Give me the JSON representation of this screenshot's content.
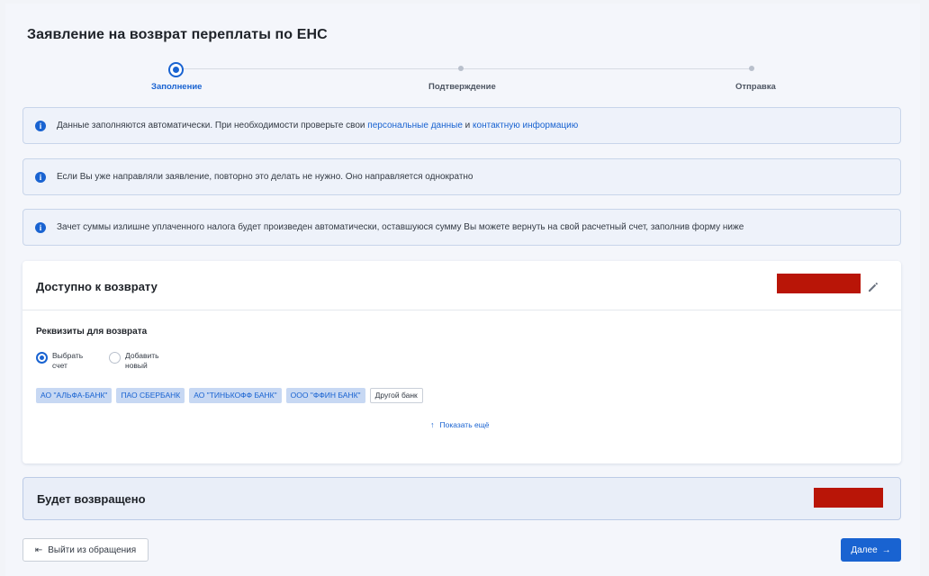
{
  "title": "Заявление на возврат переплаты по ЕНС",
  "stepper": {
    "steps": [
      {
        "label": "Заполнение",
        "state": "active"
      },
      {
        "label": "Подтверждение",
        "state": "pending"
      },
      {
        "label": "Отправка",
        "state": "pending"
      }
    ]
  },
  "info_boxes": [
    {
      "icon": "info-icon",
      "text_before": "Данные заполняются автоматически. При необходимости проверьте свои ",
      "link1": "персональные данные",
      "text_middle": " и ",
      "link2": "контактную информацию"
    },
    {
      "icon": "info-icon",
      "text": "Если Вы уже направляли заявление, повторно это делать не нужно. Оно направляется однократно"
    },
    {
      "icon": "info-icon",
      "text": "Зачет суммы излишне уплаченного налога будет произведен автоматически, оставшуюся сумму Вы можете вернуть на свой расчетный счет, заполнив форму ниже"
    }
  ],
  "available": {
    "title": "Доступно к возврату",
    "edit_icon": "pencil-icon",
    "requisites_title": "Реквизиты для возврата",
    "radio_options": [
      {
        "label": "Выбрать счет",
        "checked": true
      },
      {
        "label": "Добавить новый",
        "checked": false
      }
    ],
    "banks": [
      "АО \"АЛЬФА-БАНК\"",
      "ПАО СБЕРБАНК",
      "АО \"ТИНЬКОФФ БАНК\"",
      "ООО \"ФФИН БАНК\"",
      "Другой банк"
    ],
    "show_more": "Показать ещё"
  },
  "returned": {
    "title": "Будет возвращено"
  },
  "buttons": {
    "exit": "Выйти из обращения",
    "next": "Далее"
  },
  "colors": {
    "accent": "#1963d1",
    "redaction": "#b91507",
    "bank_chip_bg": "#c7d8f3"
  }
}
